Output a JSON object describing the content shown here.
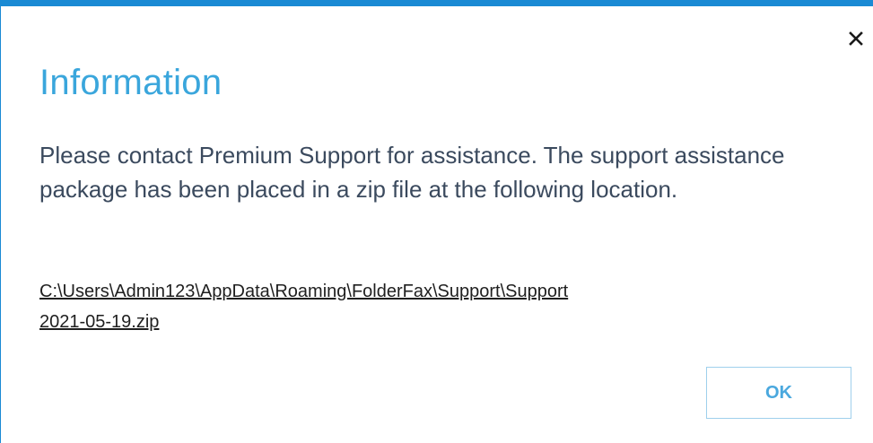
{
  "dialog": {
    "title": "Information",
    "message": "Please contact Premium Support for assistance. The support assistance package has been placed in a zip file at the following location.",
    "path_line1": "C:\\Users\\Admin123\\AppData\\Roaming\\FolderFax\\Support\\Support",
    "path_line2": "2021-05-19.zip",
    "ok_label": "OK",
    "close_icon": "close-icon"
  },
  "colors": {
    "accent": "#1a8ad4",
    "title": "#3aa6dc",
    "message": "#3b4a5e",
    "button_border": "#9fd0ec",
    "button_text": "#4aa8de"
  }
}
